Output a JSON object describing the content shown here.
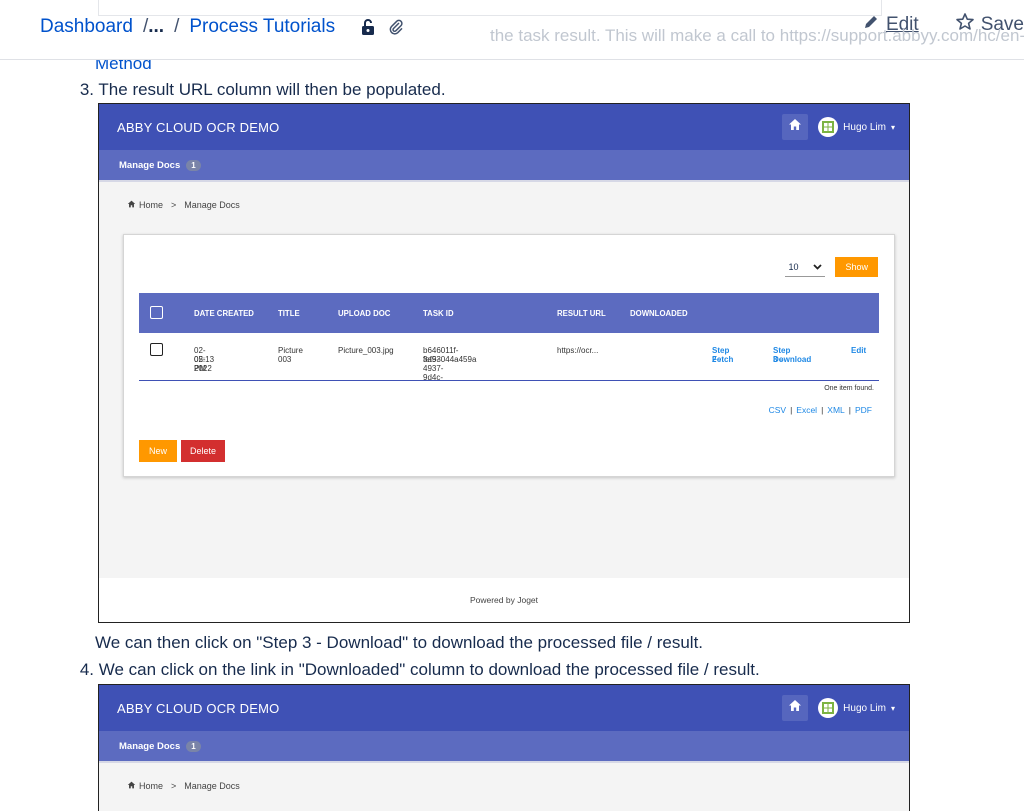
{
  "topbar": {
    "breadcrumb_root": "Dashboard",
    "breadcrumb_sep": "/",
    "breadcrumb_ellipsis": "...",
    "breadcrumb_current": "Process Tutorials",
    "edit_label": "Edit",
    "save_label": "Save",
    "ghost_text": "the task result. This will make a call to https://support.abbyy.com/hc/en-us"
  },
  "content": {
    "method_text": "Method",
    "step3_num": "3.",
    "step3_text": "The result URL column will then be populated.",
    "note_text": "We can then click on \"Step 3 - Download\" to download the processed file / result.",
    "step4_num": "4.",
    "step4_text": "We can click on the link in \"Downloaded\" column to download the processed file / result."
  },
  "app": {
    "title": "ABBY CLOUD OCR DEMO",
    "user_name": "Hugo Lim",
    "nav_item": "Manage Docs",
    "nav_badge": "1",
    "crumb_home": "Home",
    "crumb_sep": ">",
    "crumb_current": "Manage Docs",
    "page_size": "10",
    "show_label": "Show",
    "columns": [
      "DATE CREATED",
      "TITLE",
      "UPLOAD DOC",
      "TASK ID",
      "RESULT URL",
      "DOWNLOADED"
    ],
    "row": {
      "date_line1": "02-05-2022",
      "date_line2": "02:13 PM",
      "title_line1": "Picture",
      "title_line2": "003",
      "upload_doc": "Picture_003.jpg",
      "task_id_line1": "b646011f-fef9-4937-9d4c-",
      "task_id_line2": "3a53044a459a",
      "result_url": "https://ocr...",
      "step2_line1": "Step 2 -",
      "step2_line2": "Fetch",
      "step3_line1": "Step 3 -",
      "step3_line2": "Download",
      "edit": "Edit"
    },
    "found_text": "One item found.",
    "exports": [
      "CSV",
      "Excel",
      "XML",
      "PDF"
    ],
    "export_sep": "|",
    "new_label": "New",
    "delete_label": "Delete",
    "footer_text": "Powered by Joget"
  },
  "colors": {
    "header_blue": "#3f51b5",
    "subnav_blue": "#5c6bc0",
    "orange": "#ff9800",
    "red": "#d32f2f",
    "link": "#0052cc"
  }
}
